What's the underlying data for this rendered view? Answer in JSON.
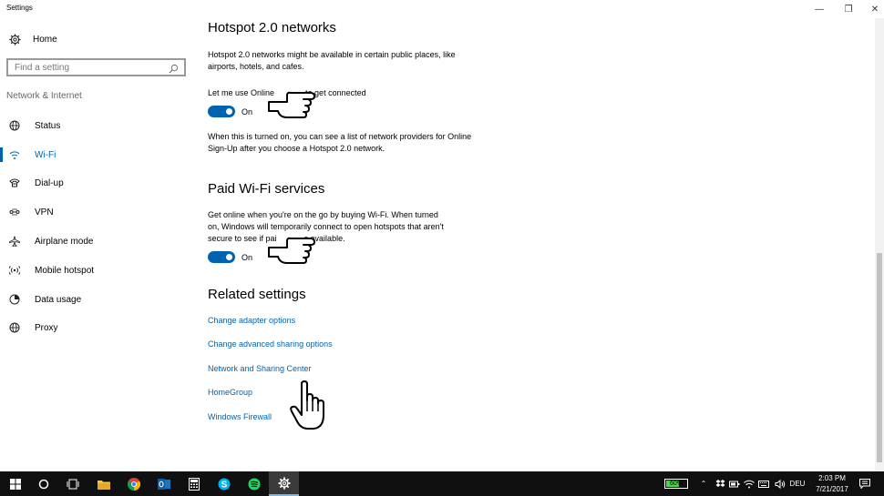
{
  "window": {
    "title": "Settings",
    "minimize_glyph": "—",
    "restore_glyph": "❐",
    "close_glyph": "✕"
  },
  "sidebar": {
    "home_label": "Home",
    "search_placeholder": "Find a setting",
    "section_header": "Network & Internet",
    "items": [
      {
        "label": "Status",
        "icon": "globe-status-icon"
      },
      {
        "label": "Wi-Fi",
        "icon": "wifi-icon",
        "active": true
      },
      {
        "label": "Dial-up",
        "icon": "dialup-icon"
      },
      {
        "label": "VPN",
        "icon": "vpn-icon"
      },
      {
        "label": "Airplane mode",
        "icon": "airplane-icon"
      },
      {
        "label": "Mobile hotspot",
        "icon": "hotspot-icon"
      },
      {
        "label": "Data usage",
        "icon": "data-usage-icon"
      },
      {
        "label": "Proxy",
        "icon": "globe-icon"
      }
    ]
  },
  "main": {
    "hotspot": {
      "title": "Hotspot 2.0 networks",
      "description": "Hotspot 2.0 networks might be available in certain public places, like airports, hotels, and cafes.",
      "toggle_label": "Let me use Online",
      "toggle_label_tail": "to get connected",
      "toggle_state": "On",
      "note": "When this is turned on, you can see a list of network providers for Online Sign-Up after you choose a Hotspot 2.0 network."
    },
    "paid_wifi": {
      "title": "Paid Wi-Fi services",
      "description_line1": "Get online when you're on the go by buying Wi-Fi. When turned",
      "description_line2": "on, Windows will temporarily connect to open hotspots that aren't",
      "description_line3_a": "secure to see if pai",
      "description_line3_b": "s available.",
      "toggle_state": "On"
    },
    "related": {
      "title": "Related settings",
      "links": [
        "Change adapter options",
        "Change advanced sharing options",
        "Network and Sharing Center",
        "HomeGroup",
        "Windows Firewall"
      ]
    }
  },
  "taskbar": {
    "battery_percent": "60%",
    "language": "DEU",
    "time": "2:03 PM",
    "date": "7/21/2017",
    "accent": "#76b9ed",
    "apps": [
      "start-icon",
      "cortana-icon",
      "task-view-icon",
      "file-explorer-icon",
      "chrome-icon",
      "outlook-icon",
      "calculator-icon",
      "skype-icon",
      "spotify-icon",
      "settings-icon"
    ]
  },
  "colors": {
    "accent": "#0063b1",
    "taskbar": "#101010"
  }
}
